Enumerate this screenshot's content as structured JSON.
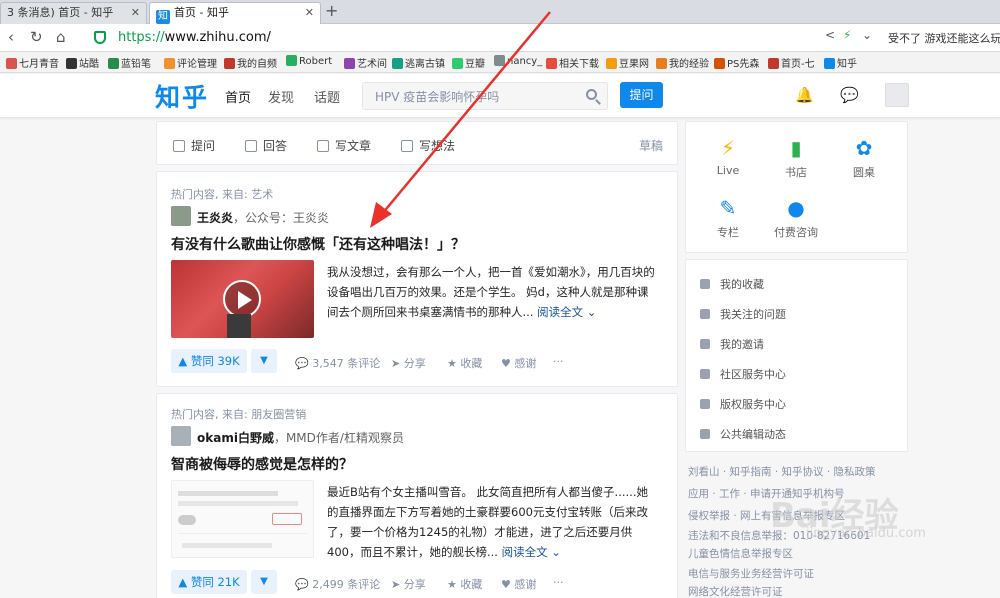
{
  "browser": {
    "tabs": [
      {
        "label": "3 条消息) 首页 - 知乎",
        "active": false
      },
      {
        "label": "首页 - 知乎",
        "active": true
      }
    ],
    "new_tab": "+",
    "url_proto": "https://",
    "url_host": "www.zhihu.com/",
    "hot_search": "受不了 游戏还能这么玩",
    "bookmarks": [
      "七月青音",
      "站酷",
      "蓝铅笔",
      "评论管理",
      "我的自频",
      "Robert",
      "艺术间",
      "逃离古镇",
      "豆瓣",
      "nancy_",
      "相关下载",
      "豆果网",
      "我的经验",
      "PS先森",
      "首页-七",
      "知乎"
    ]
  },
  "header": {
    "logo": "知乎",
    "nav": [
      "首页",
      "发现",
      "话题"
    ],
    "search_placeholder": "HPV 疫苗会影响怀孕吗",
    "ask_label": "提问"
  },
  "writebar": {
    "items": [
      "提问",
      "回答",
      "写文章",
      "写想法"
    ],
    "draft": "草稿"
  },
  "feed": [
    {
      "source": "热门内容, 来自: 艺术",
      "author_name": "王炎炎",
      "author_desc": "，公众号：王炎炎",
      "title": "有没有什么歌曲让你感慨「还有这种唱法！」？",
      "excerpt": "我从没想过，会有那么一个人，把一首《爱如潮水》，用几百块的设备唱出几百万的效果。还是个学生。 妈d，这种人就是那种课间去个厕所回来书桌塞满情书的那种人...",
      "read_more": "阅读全文",
      "upvotes": "赞同 39K",
      "comments": "3,547 条评论",
      "share": "分享",
      "collect": "收藏",
      "thanks": "感谢",
      "more": "···"
    },
    {
      "source": "热门内容, 来自: 朋友圈营销",
      "author_name": "okami白野威",
      "author_desc": "，MMD作者/杠精观察员",
      "title": "智商被侮辱的感觉是怎样的？",
      "excerpt": "最近B站有个女主播叫雪音。 此女简直把所有人都当傻子......她的直播界面左下方写着她的土豪群要600元支付宝转账（后来改了，要一个价格为1245的礼物）才能进，进了之后还要月供400，而且不累计，她的舰长榜...",
      "read_more": "阅读全文",
      "upvotes": "赞同 21K",
      "comments": "2,499 条评论",
      "share": "分享",
      "collect": "收藏",
      "thanks": "感谢",
      "more": "···"
    }
  ],
  "sidebar": {
    "apps": [
      "Live",
      "书店",
      "圆桌",
      "专栏",
      "付费咨询"
    ],
    "links": [
      "我的收藏",
      "我关注的问题",
      "我的邀请",
      "社区服务中心",
      "版权服务中心",
      "公共编辑动态"
    ],
    "footer": [
      "刘看山 · 知乎指南 · 知乎协议 · 隐私政策",
      "应用 · 工作 · 申请开通知乎机构号",
      "侵权举报 · 网上有害信息举报专区",
      "违法和不良信息举报：010-82716601",
      "儿童色情信息举报专区",
      "电信与服务业务经营许可证",
      "网络文化经营许可证"
    ]
  },
  "colors": {
    "brand": "#0f88eb",
    "arrow": "#e8322b"
  }
}
